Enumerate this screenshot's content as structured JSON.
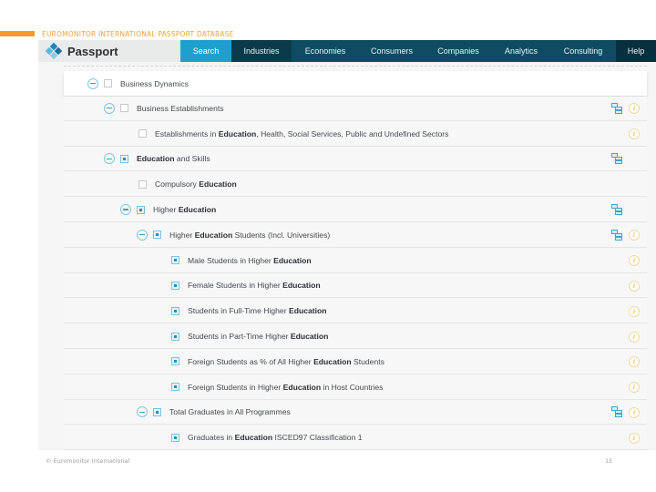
{
  "slide": {
    "title": "EUROMONITOR INTERNATIONAL PASSPORT DATABASE",
    "footer_copyright": "© Euromonitor International",
    "page_number": "13",
    "accent_color": "#f39c1f"
  },
  "app": {
    "brand": "Passport",
    "nav": [
      {
        "label": "Search",
        "active": true
      },
      {
        "label": "Industries"
      },
      {
        "label": "Economies"
      },
      {
        "label": "Consumers"
      },
      {
        "label": "Companies"
      },
      {
        "label": "Analytics"
      },
      {
        "label": "Consulting"
      },
      {
        "label": "Help"
      }
    ]
  },
  "tree": {
    "rows": [
      {
        "pre": "",
        "bold": "",
        "post": "Business Dynamics",
        "level": 0,
        "expandable": true,
        "checked": false,
        "grid_icon": false,
        "info_icon": false
      },
      {
        "pre": "",
        "bold": "",
        "post": "Business Establishments",
        "level": 1,
        "expandable": true,
        "checked": false,
        "grid_icon": true,
        "info_icon": true
      },
      {
        "pre": "Establishments in ",
        "bold": "Education",
        "post": ", Health, Social Services, Public and Undefined Sectors",
        "level": 2,
        "expandable": false,
        "checked": false,
        "grid_icon": false,
        "info_icon": true
      },
      {
        "pre": "",
        "bold": "Education",
        "post": " and Skills",
        "level": 1,
        "expandable": true,
        "checked": true,
        "grid_icon": true,
        "info_icon": false
      },
      {
        "pre": "Compulsory ",
        "bold": "Education",
        "post": "",
        "level": 2,
        "expandable": false,
        "checked": false,
        "grid_icon": false,
        "info_icon": false
      },
      {
        "pre": "Higher ",
        "bold": "Education",
        "post": "",
        "level": 2,
        "expandable": true,
        "checked": true,
        "grid_icon": true,
        "info_icon": false
      },
      {
        "pre": "Higher ",
        "bold": "Education",
        "post": " Students (Incl. Universities)",
        "level": 3,
        "expandable": true,
        "checked": true,
        "grid_icon": true,
        "info_icon": true
      },
      {
        "pre": "Male Students in Higher ",
        "bold": "Education",
        "post": "",
        "level": 4,
        "expandable": false,
        "checked": true,
        "grid_icon": false,
        "info_icon": true
      },
      {
        "pre": "Female Students in Higher ",
        "bold": "Education",
        "post": "",
        "level": 4,
        "expandable": false,
        "checked": true,
        "grid_icon": false,
        "info_icon": true
      },
      {
        "pre": "Students in Full-Time Higher ",
        "bold": "Education",
        "post": "",
        "level": 4,
        "expandable": false,
        "checked": true,
        "grid_icon": false,
        "info_icon": true
      },
      {
        "pre": "Students in Part-Time Higher ",
        "bold": "Education",
        "post": "",
        "level": 4,
        "expandable": false,
        "checked": true,
        "grid_icon": false,
        "info_icon": true
      },
      {
        "pre": "Foreign Students as % of All Higher ",
        "bold": "Education",
        "post": " Students",
        "level": 4,
        "expandable": false,
        "checked": true,
        "grid_icon": false,
        "info_icon": true
      },
      {
        "pre": "Foreign Students in Higher ",
        "bold": "Education",
        "post": " in Host Countries",
        "level": 4,
        "expandable": false,
        "checked": true,
        "grid_icon": false,
        "info_icon": true
      },
      {
        "pre": "Total Graduates in All Programmes",
        "bold": "",
        "post": "",
        "level": 3,
        "expandable": true,
        "checked": true,
        "grid_icon": true,
        "info_icon": true
      },
      {
        "pre": "Graduates in ",
        "bold": "Education",
        "post": " ISCED97 Classification 1",
        "level": 4,
        "expandable": false,
        "checked": true,
        "grid_icon": false,
        "info_icon": true
      }
    ]
  }
}
